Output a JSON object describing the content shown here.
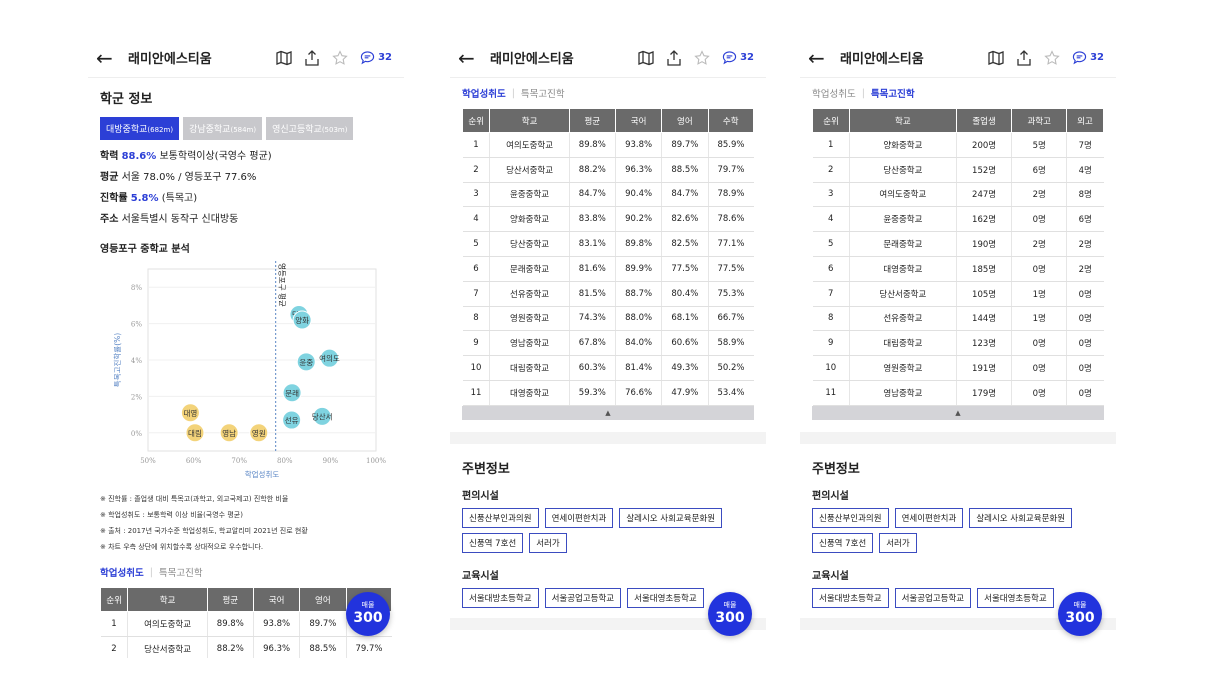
{
  "app": {
    "title": "래미안에스티움",
    "comment_count": "32"
  },
  "school": {
    "section_title": "학군 정보",
    "chips": [
      {
        "name": "대방중학교",
        "dist": "(682m)"
      },
      {
        "name": "강남중학교",
        "dist": "(584m)"
      },
      {
        "name": "영신고등학교",
        "dist": "(503m)"
      }
    ],
    "lines": [
      {
        "label": "학력",
        "value_hl": "88.6%",
        "value": "보통학력이상(국영수 평균)"
      },
      {
        "label": "평균",
        "value_hl": "",
        "value": "서울 78.0% / 영등포구 77.6%"
      },
      {
        "label": "진학률",
        "value_hl": "5.8%",
        "value": "(특목고)"
      },
      {
        "label": "주소",
        "value_hl": "",
        "value": "서울특별시 동작구 신대방동"
      }
    ]
  },
  "chart_data": {
    "type": "scatter",
    "title": "영등포구 중학교 분석",
    "xlabel": "학업성취도",
    "ylabel": "특목고진학률(%)",
    "xlim": [
      50,
      100
    ],
    "ylim": [
      -1,
      9
    ],
    "xticks": [
      "50%",
      "60%",
      "70%",
      "80%",
      "90%",
      "100%"
    ],
    "yticks": [
      "0%",
      "2%",
      "4%",
      "6%",
      "8%"
    ],
    "ref_line": {
      "x": 78,
      "label": "영등포구 평균"
    },
    "points": [
      {
        "label": "대영",
        "x": 59.3,
        "y": 1.1,
        "color": "#f3d37a"
      },
      {
        "label": "대림",
        "x": 60.3,
        "y": 0.0,
        "color": "#f3d37a"
      },
      {
        "label": "영남",
        "x": 67.8,
        "y": 0.0,
        "color": "#f3d37a"
      },
      {
        "label": "영원",
        "x": 74.3,
        "y": 0.0,
        "color": "#f3d37a"
      },
      {
        "label": "당산",
        "x": 83.1,
        "y": 6.5,
        "color": "#7fd3e0"
      },
      {
        "label": "양화",
        "x": 83.8,
        "y": 6.2,
        "color": "#7fd3e0"
      },
      {
        "label": "여의도",
        "x": 89.8,
        "y": 4.1,
        "color": "#7fd3e0"
      },
      {
        "label": "윤중",
        "x": 84.7,
        "y": 3.9,
        "color": "#7fd3e0"
      },
      {
        "label": "문래",
        "x": 81.6,
        "y": 2.2,
        "color": "#7fd3e0"
      },
      {
        "label": "선유",
        "x": 81.5,
        "y": 0.7,
        "color": "#7fd3e0"
      },
      {
        "label": "당산서",
        "x": 88.2,
        "y": 0.9,
        "color": "#7fd3e0"
      }
    ]
  },
  "notes": [
    "※ 진학률 : 졸업생 대비 특목고(과학고, 외고국제고) 진학한 비율",
    "※ 학업성취도 : 보통학력 이상 비율(국영수 평균)",
    "※ 출처 : 2017년 국가수준 학업성취도, 학교알리미 2021년 진로 현황",
    "※ 차트 우측 상단에 위치할수록 상대적으로 우수합니다."
  ],
  "tabs": {
    "achievement": "학업성취도",
    "special": "특목고진학"
  },
  "achievement_table": {
    "headers": [
      "순위",
      "학교",
      "평균",
      "국어",
      "영어",
      "수학"
    ],
    "rows": [
      [
        "1",
        "여의도중학교",
        "89.8%",
        "93.8%",
        "89.7%",
        "85.9%"
      ],
      [
        "2",
        "당산서중학교",
        "88.2%",
        "96.3%",
        "88.5%",
        "79.7%"
      ],
      [
        "3",
        "윤중중학교",
        "84.7%",
        "90.4%",
        "84.7%",
        "78.9%"
      ],
      [
        "4",
        "양화중학교",
        "83.8%",
        "90.2%",
        "82.6%",
        "78.6%"
      ],
      [
        "5",
        "당산중학교",
        "83.1%",
        "89.8%",
        "82.5%",
        "77.1%"
      ],
      [
        "6",
        "문래중학교",
        "81.6%",
        "89.9%",
        "77.5%",
        "77.5%"
      ],
      [
        "7",
        "선유중학교",
        "81.5%",
        "88.7%",
        "80.4%",
        "75.3%"
      ],
      [
        "8",
        "영원중학교",
        "74.3%",
        "88.0%",
        "68.1%",
        "66.7%"
      ],
      [
        "9",
        "영남중학교",
        "67.8%",
        "84.0%",
        "60.6%",
        "58.9%"
      ],
      [
        "10",
        "대림중학교",
        "60.3%",
        "81.4%",
        "49.3%",
        "50.2%"
      ],
      [
        "11",
        "대영중학교",
        "59.3%",
        "76.6%",
        "47.9%",
        "53.4%"
      ]
    ]
  },
  "special_table": {
    "headers": [
      "순위",
      "학교",
      "졸업생",
      "과학고",
      "외고"
    ],
    "rows": [
      [
        "1",
        "양화중학교",
        "200명",
        "5명",
        "7명"
      ],
      [
        "2",
        "당산중학교",
        "152명",
        "6명",
        "4명"
      ],
      [
        "3",
        "여의도중학교",
        "247명",
        "2명",
        "8명"
      ],
      [
        "4",
        "윤중중학교",
        "162명",
        "0명",
        "6명"
      ],
      [
        "5",
        "문래중학교",
        "190명",
        "2명",
        "2명"
      ],
      [
        "6",
        "대영중학교",
        "185명",
        "0명",
        "2명"
      ],
      [
        "7",
        "당산서중학교",
        "105명",
        "1명",
        "0명"
      ],
      [
        "8",
        "선유중학교",
        "144명",
        "1명",
        "0명"
      ],
      [
        "9",
        "대림중학교",
        "123명",
        "0명",
        "0명"
      ],
      [
        "10",
        "영원중학교",
        "191명",
        "0명",
        "0명"
      ],
      [
        "11",
        "영남중학교",
        "179명",
        "0명",
        "0명"
      ]
    ]
  },
  "around": {
    "title": "주변정보",
    "convenience_title": "편의시설",
    "convenience": [
      "신풍산부인과의원",
      "연세이편한치과",
      "살레시오 사회교육문화원",
      "신풍역 7호선",
      "서러가"
    ],
    "education_title": "교육시설",
    "education": [
      "서울대방초등학교",
      "서울공업고등학교",
      "서울대영초등학교"
    ]
  },
  "badge": {
    "label": "매물",
    "count": "300"
  }
}
